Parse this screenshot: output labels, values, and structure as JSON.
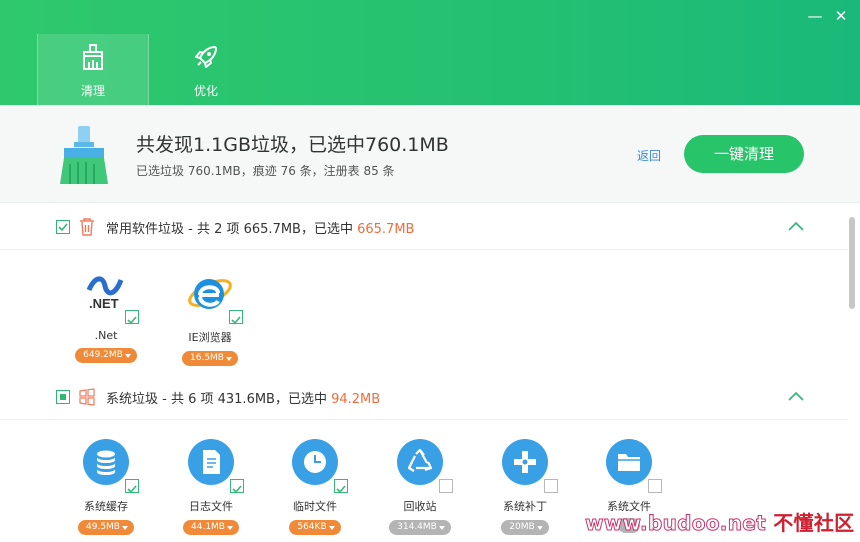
{
  "window": {
    "minimize_glyph": "—",
    "close_glyph": "✕"
  },
  "tabs": [
    {
      "label": "清理",
      "icon": "broom-icon",
      "active": true
    },
    {
      "label": "优化",
      "icon": "rocket-icon",
      "active": false
    }
  ],
  "summary": {
    "title": "共发现1.1GB垃圾，已选中760.1MB",
    "subtitle": "已选垃圾 760.1MB，痕迹 76 条，注册表 85 条",
    "return_label": "返回",
    "clean_button": "一键清理"
  },
  "sections": [
    {
      "title_prefix": "常用软件垃圾 - 共 2 项 665.7MB，已选中 ",
      "title_selected": "665.7MB",
      "checkbox_state": "checked",
      "icon": "trash-icon",
      "items": [
        {
          "name": ".Net",
          "size": "649.2MB",
          "checked": true,
          "icon": "dotnet-icon"
        },
        {
          "name": "IE浏览器",
          "size": "16.5MB",
          "checked": true,
          "icon": "ie-icon"
        }
      ]
    },
    {
      "title_prefix": "系统垃圾 - 共 6 项 431.6MB，已选中 ",
      "title_selected": "94.2MB",
      "checkbox_state": "partial",
      "icon": "windows-icon",
      "items": [
        {
          "name": "系统缓存",
          "size": "49.5MB",
          "checked": true,
          "icon": "database-icon"
        },
        {
          "name": "日志文件",
          "size": "44.1MB",
          "checked": true,
          "icon": "document-icon"
        },
        {
          "name": "临时文件",
          "size": "564KB",
          "checked": true,
          "icon": "clock-icon"
        },
        {
          "name": "回收站",
          "size": "314.4MB",
          "checked": false,
          "icon": "recycle-icon"
        },
        {
          "name": "系统补丁",
          "size": "20MB",
          "checked": false,
          "icon": "puzzle-icon"
        },
        {
          "name": "系统文件",
          "size": "",
          "checked": false,
          "icon": "folder-icon"
        }
      ]
    }
  ],
  "watermark": {
    "site": "www.budoo.net",
    "cn": "不懂社区"
  },
  "colors": {
    "accent": "#27c46a",
    "highlight": "#f06c3c",
    "pill_orange": "#f08a38",
    "pill_gray": "#b4b4b4",
    "icon_blue": "#3aa0e6"
  }
}
